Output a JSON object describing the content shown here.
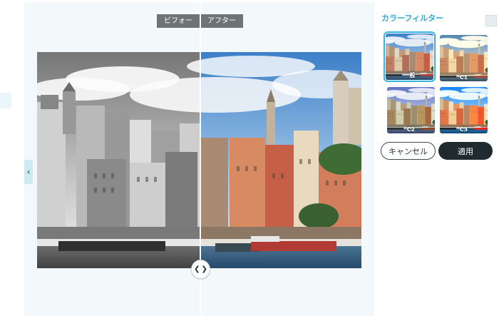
{
  "compare": {
    "before_label": "ビフォー",
    "after_label": "アフター",
    "split_fraction": 0.5
  },
  "icons": {
    "side_handle": "chevron-left-icon",
    "divider": "chevron-left-right-icon"
  },
  "filter_panel": {
    "title": "カラーフィルター",
    "filters": [
      {
        "label": "一般",
        "selected": true
      },
      {
        "label": "C1",
        "selected": false
      },
      {
        "label": "C2",
        "selected": false
      },
      {
        "label": "C3",
        "selected": false
      }
    ]
  },
  "actions": {
    "cancel_label": "キャンセル",
    "apply_label": "適用"
  },
  "colors": {
    "accent": "#2aa9d6",
    "apply_button": "#1f2b2f",
    "label_background": "#6e7476"
  }
}
